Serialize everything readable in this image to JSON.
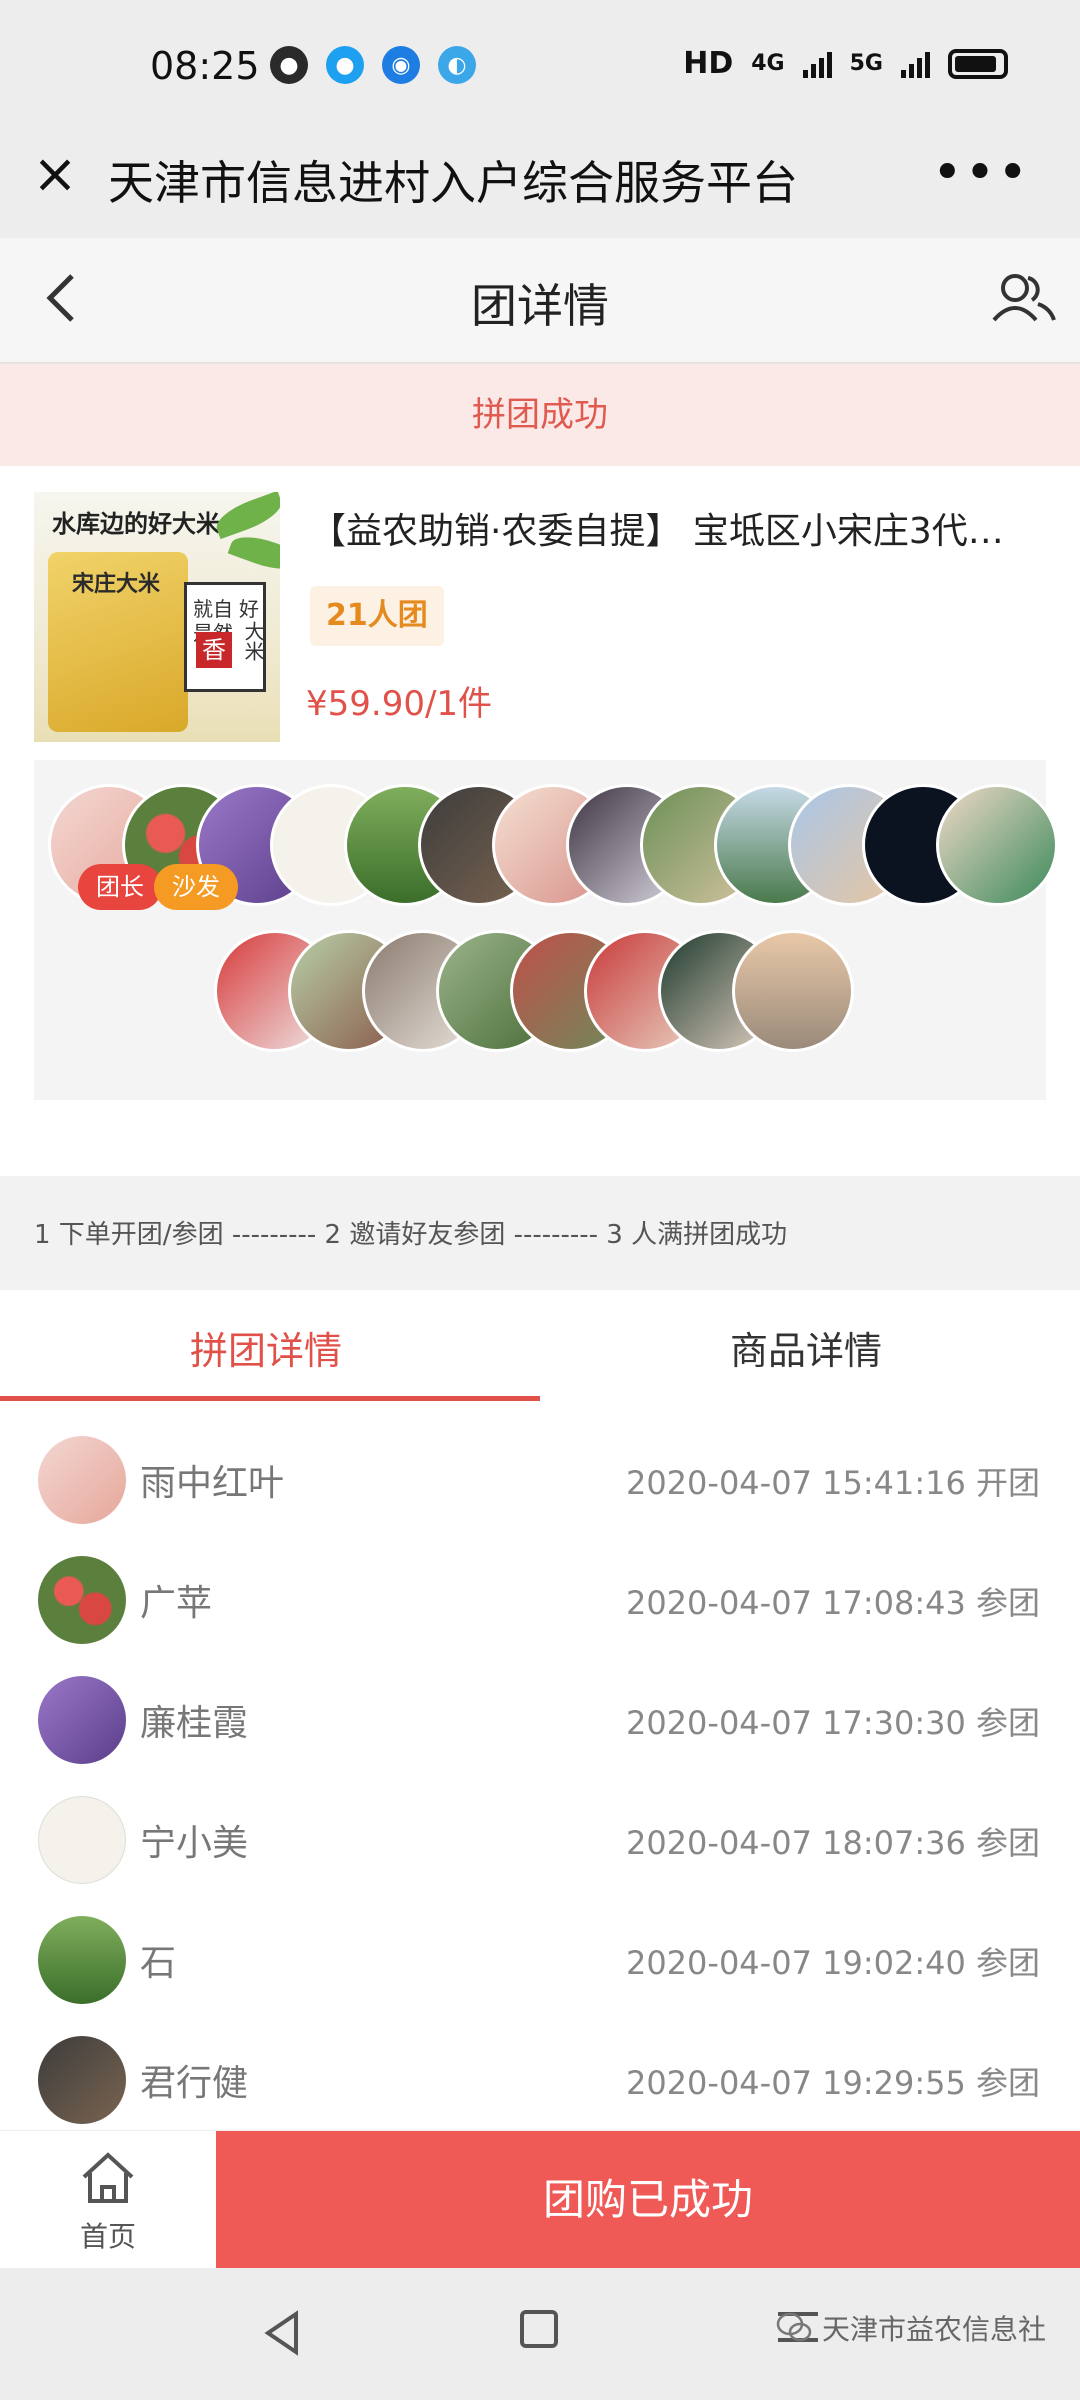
{
  "status_bar": {
    "time": "08:25",
    "network_label": "HD",
    "sim1": "4G",
    "sim2": "5G",
    "apps": [
      "wechat-icon",
      "qq-icon",
      "browser-icon",
      "vpn-icon"
    ]
  },
  "title_bar": {
    "title": "天津市信息进村入户综合服务平台",
    "more": "•••"
  },
  "header": {
    "title": "团详情"
  },
  "banner": {
    "text": "拼团成功"
  },
  "product": {
    "image_text": "水库边的好大米",
    "bag_text": "宋庄大米",
    "box_text": [
      "就自",
      "是然",
      "好",
      "大米"
    ],
    "box_red": "香",
    "title": "【益农助销·农委自提】 宝坻区小宋庄3代…",
    "group_badge": "21人团",
    "price": "¥59.90/1件"
  },
  "members": {
    "leader_tag": "团长",
    "sofa_tag": "沙发",
    "row1_count": 13,
    "row2_count": 8
  },
  "steps": {
    "text": "1 下单开团/参团 --------- 2 邀请好友参团 --------- 3 人满拼团成功"
  },
  "tabs": [
    {
      "label": "拼团详情",
      "active": true
    },
    {
      "label": "商品详情",
      "active": false
    }
  ],
  "participants": [
    {
      "name": "雨中红叶",
      "time": "2020-04-07 15:41:16 开团"
    },
    {
      "name": "广苹",
      "time": "2020-04-07 17:08:43 参团"
    },
    {
      "name": "廉桂霞",
      "time": "2020-04-07 17:30:30 参团"
    },
    {
      "name": "宁小美",
      "time": "2020-04-07 18:07:36 参团"
    },
    {
      "name": "石",
      "time": "2020-04-07 19:02:40 参团"
    },
    {
      "name": "君行健",
      "time": "2020-04-07 19:29:55 参团"
    }
  ],
  "action_bar": {
    "home_label": "首页",
    "status_button": "团购已成功"
  },
  "watermark": {
    "text": "天津市益农信息社"
  },
  "colors": {
    "accent": "#e0514a",
    "button": "#ef5a56",
    "banner_bg": "#fbe9e8",
    "badge_text": "#e58a1f"
  }
}
